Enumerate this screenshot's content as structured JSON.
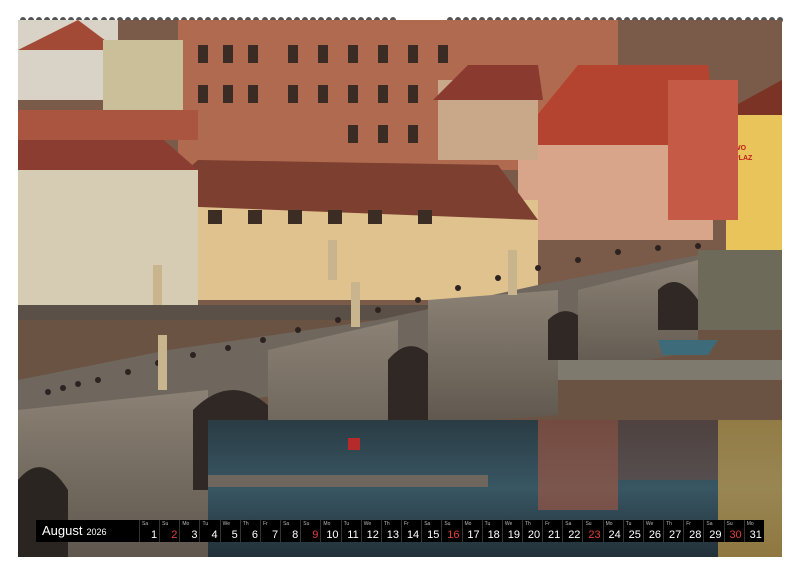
{
  "calendar": {
    "month": "August",
    "year": "2026",
    "weekdays": [
      "Sa",
      "Su",
      "Mo",
      "Tu",
      "We",
      "Th",
      "Fr",
      "Sa",
      "Su",
      "Mo",
      "Tu",
      "We",
      "Th",
      "Fr",
      "Sa",
      "Su",
      "Mo",
      "Tu",
      "We",
      "Th",
      "Fr",
      "Sa",
      "Su",
      "Mo",
      "Tu",
      "We",
      "Th",
      "Fr",
      "Sa",
      "Su",
      "Mo"
    ],
    "days": [
      "1",
      "2",
      "3",
      "4",
      "5",
      "6",
      "7",
      "8",
      "9",
      "10",
      "11",
      "12",
      "13",
      "14",
      "15",
      "16",
      "17",
      "18",
      "19",
      "20",
      "21",
      "22",
      "23",
      "24",
      "25",
      "26",
      "27",
      "28",
      "29",
      "30",
      "31"
    ],
    "highlighted_days": [
      "2",
      "9",
      "16",
      "23",
      "30"
    ],
    "highlight_color": "#e0403a"
  },
  "photo": {
    "sign_text": "PLAZ",
    "sign_logo": "WO"
  }
}
